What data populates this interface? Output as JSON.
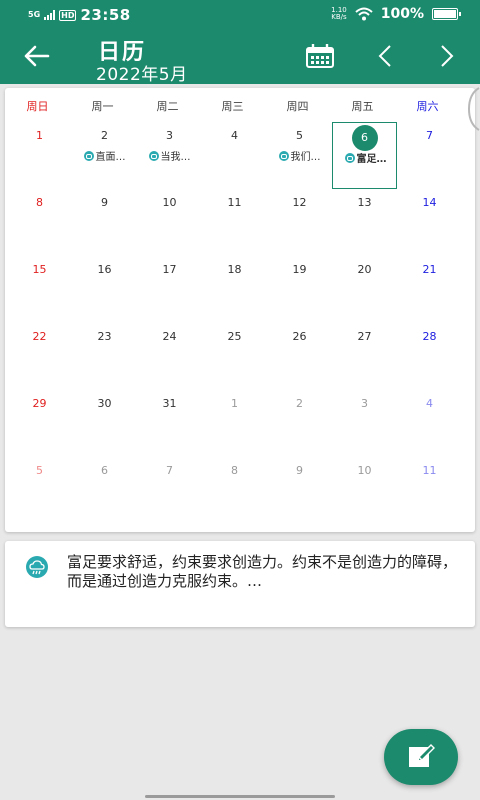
{
  "status_bar": {
    "network": "5G",
    "hd": "HD",
    "time": "23:58",
    "speed_value": "1.10",
    "speed_unit": "KB/s",
    "battery": "100%",
    "battery_level": 1.0
  },
  "header": {
    "title": "日历",
    "month": "2022年5月",
    "back_icon": "arrow-left-icon",
    "calendar_icon": "calendar-icon",
    "prev_icon": "chevron-left-icon",
    "next_icon": "chevron-right-icon"
  },
  "calendar": {
    "weekdays": [
      "周日",
      "周一",
      "周二",
      "周三",
      "周四",
      "周五",
      "周六"
    ],
    "rows": [
      [
        {
          "day": "1"
        },
        {
          "day": "2",
          "event": "直面…"
        },
        {
          "day": "3",
          "event": "当我…"
        },
        {
          "day": "4"
        },
        {
          "day": "5",
          "event": "我们…"
        },
        {
          "day": "6",
          "event": "富足…",
          "today": true
        },
        {
          "day": "7"
        }
      ],
      [
        {
          "day": "8"
        },
        {
          "day": "9"
        },
        {
          "day": "10"
        },
        {
          "day": "11"
        },
        {
          "day": "12"
        },
        {
          "day": "13"
        },
        {
          "day": "14"
        }
      ],
      [
        {
          "day": "15"
        },
        {
          "day": "16"
        },
        {
          "day": "17"
        },
        {
          "day": "18"
        },
        {
          "day": "19"
        },
        {
          "day": "20"
        },
        {
          "day": "21"
        }
      ],
      [
        {
          "day": "22"
        },
        {
          "day": "23"
        },
        {
          "day": "24"
        },
        {
          "day": "25"
        },
        {
          "day": "26"
        },
        {
          "day": "27"
        },
        {
          "day": "28"
        }
      ],
      [
        {
          "day": "29"
        },
        {
          "day": "30"
        },
        {
          "day": "31"
        },
        {
          "day": "1",
          "other": true
        },
        {
          "day": "2",
          "other": true
        },
        {
          "day": "3",
          "other": true
        },
        {
          "day": "4",
          "other": true
        }
      ],
      [
        {
          "day": "5",
          "other": true
        },
        {
          "day": "6",
          "other": true
        },
        {
          "day": "7",
          "other": true
        },
        {
          "day": "8",
          "other": true
        },
        {
          "day": "9",
          "other": true
        },
        {
          "day": "10",
          "other": true
        },
        {
          "day": "11",
          "other": true
        }
      ]
    ]
  },
  "quote": {
    "icon": "cloud-quote-icon",
    "text": "富足要求舒适，约束要求创造力。约束不是创造力的障碍，而是通过创造力克服约束。…"
  },
  "fab": {
    "icon": "edit-icon"
  },
  "colors": {
    "primary": "#1c8a6d",
    "sunday": "#e02020",
    "saturday": "#2020e0",
    "event_icon": "#2aaab0"
  }
}
